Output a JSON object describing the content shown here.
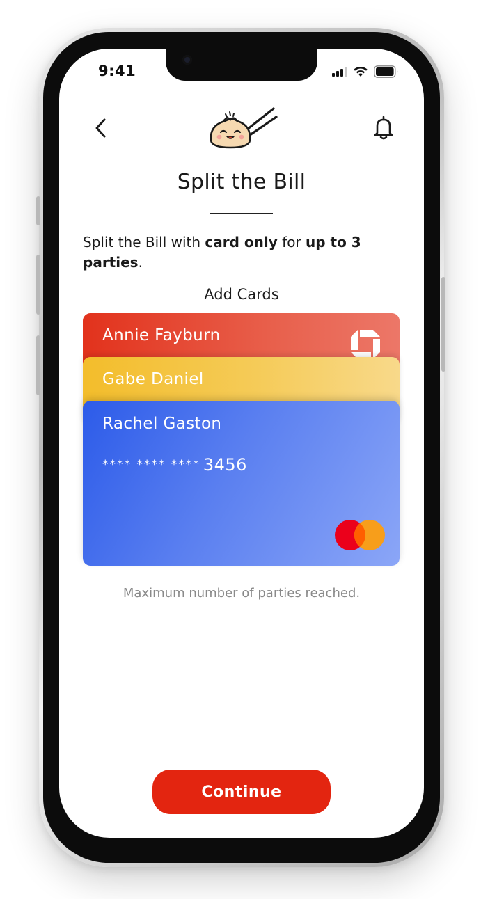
{
  "status_bar": {
    "time": "9:41"
  },
  "header": {
    "back_icon": "chevron-left-icon",
    "logo": "dumpling-chopsticks-logo",
    "bell_icon": "bell-icon"
  },
  "page": {
    "title": "Split the Bill",
    "intro": {
      "prefix": "Split the Bill with ",
      "bold1": "card only",
      "middle": " for ",
      "bold2": "up to 3 parties",
      "suffix": "."
    },
    "add_cards_label": "Add Cards",
    "max_note": "Maximum number of parties reached."
  },
  "cards": [
    {
      "holder": "Annie Fayburn",
      "brand_icon": "chase-icon",
      "color": "#e2321c"
    },
    {
      "holder": "Gabe Daniel",
      "color": "#f3bd2b"
    },
    {
      "holder": "Rachel Gaston",
      "masked": "**** **** ****",
      "last4": "3456",
      "brand_icon": "mastercard-icon",
      "color": "#2c5be9"
    }
  ],
  "footer": {
    "continue_label": "Continue",
    "accent": "#e32510"
  }
}
